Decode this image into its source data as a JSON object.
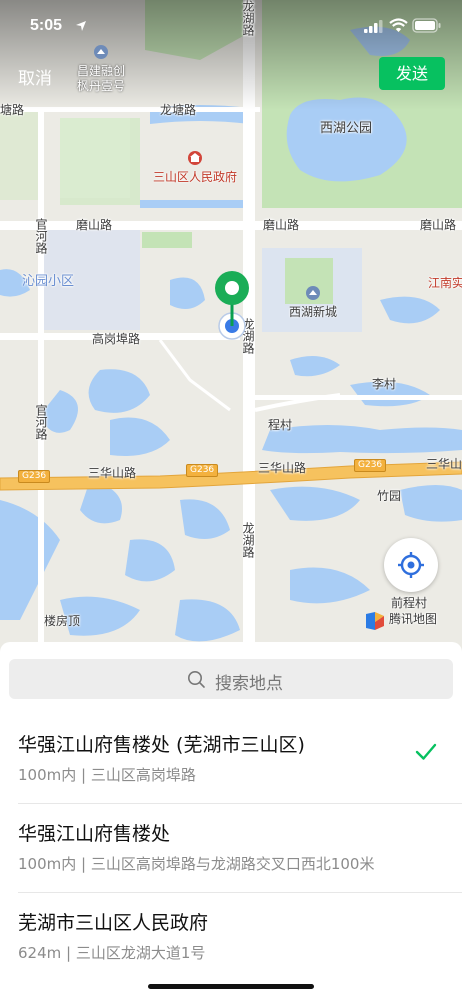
{
  "status": {
    "time": "5:05"
  },
  "toolbar": {
    "cancel_label": "取消",
    "send_label": "发送"
  },
  "map": {
    "labels": {
      "longhu_road_top": "龙湖路",
      "longhu_road_mid": "龙湖路",
      "longhu_road_low": "龙湖路",
      "longtang_road_left": "龙塘路",
      "longtang_road": "龙塘路",
      "moshan_road_left": "磨山路",
      "moshan_road_mid": "磨山路",
      "moshan_road_right": "磨山路",
      "guanhe_road_top": "官河路",
      "guanhe_road_low": "官河路",
      "qinyuan": "沁园小区",
      "gaogangbu_road": "高岗埠路",
      "xihu_park": "西湖公园",
      "xihu_xincheng": "西湖新城",
      "jiangnan": "江南实",
      "licun": "李村",
      "chengcun": "程村",
      "sanhuashan_road_left": "三华山路",
      "sanhuashan_road_mid": "三华山路",
      "sanhuashan_road_right": "三华山",
      "g236": "G236",
      "zhuyuan": "竹园",
      "loufangding": "楼房顶",
      "qianchengcun": "前程村",
      "tencent_map": "腾讯地图",
      "changjian_name": "昌建融创\n枫丹壹号",
      "gov": "三山区人民政府"
    }
  },
  "search": {
    "placeholder": "搜索地点"
  },
  "results": [
    {
      "title": "华强江山府售楼处 (芜湖市三山区)",
      "subtitle": "100m内 | 三山区高岗埠路",
      "selected": true
    },
    {
      "title": "华强江山府售楼处",
      "subtitle": "100m内 | 三山区高岗埠路与龙湖路交叉口西北100米",
      "selected": false
    },
    {
      "title": "芜湖市三山区人民政府",
      "subtitle": "624m | 三山区龙湖大道1号",
      "selected": false
    }
  ],
  "colors": {
    "accent": "#07c160",
    "water": "#a9cdf5",
    "park": "#c4e3b6"
  },
  "icons": [
    "location-arrow-icon",
    "signal-icon",
    "wifi-icon",
    "battery-icon",
    "search-icon",
    "check-icon",
    "locate-icon",
    "map-pin-icon",
    "gov-marker-icon",
    "poi-marker-icon",
    "park-marker-icon",
    "tencent-logo-icon"
  ]
}
